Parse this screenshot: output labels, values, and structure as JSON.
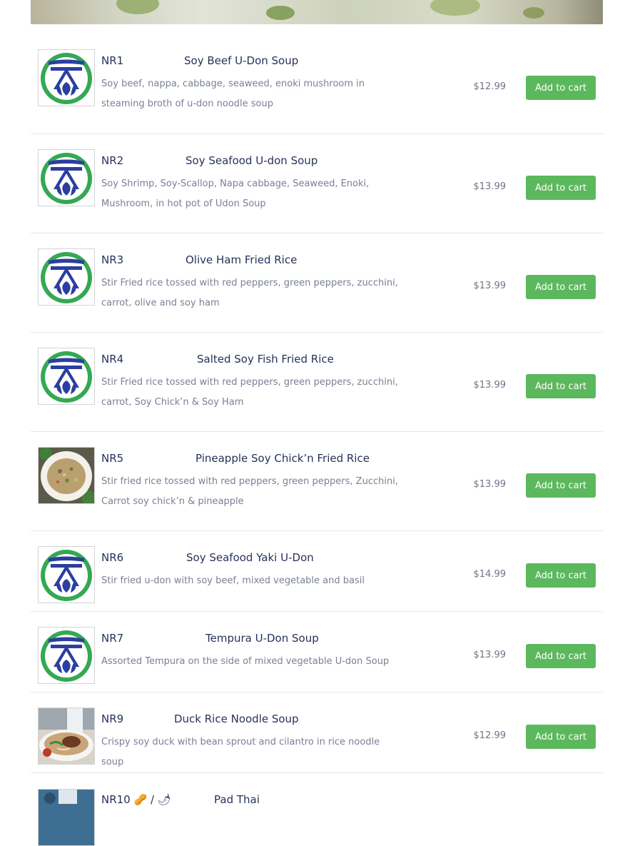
{
  "colors": {
    "accent": "#5cb85c",
    "title": "#27325a",
    "description": "#7a8095",
    "divider": "#e6e6e6"
  },
  "menu": {
    "items": [
      {
        "code": "NR1",
        "title": "Soy Beef U-Don Soup",
        "description": "Soy beef, nappa, cabbage, seaweed, enoki mushroom in steaming broth of u-don noodle soup",
        "price": "$12.99",
        "button": "Add to cart",
        "image": "logo-icon"
      },
      {
        "code": "NR2",
        "title": "Soy Seafood U-don Soup",
        "description": "Soy Shrimp, Soy-Scallop, Napa cabbage, Seaweed, Enoki, Mushroom, in hot pot of Udon Soup",
        "price": "$13.99",
        "button": "Add to cart",
        "image": "logo-icon"
      },
      {
        "code": "NR3",
        "title": "Olive Ham Fried Rice",
        "description": "Stir Fried rice tossed with red peppers, green peppers, zucchini, carrot, olive and soy ham",
        "price": "$13.99",
        "button": "Add to cart",
        "image": "logo-icon"
      },
      {
        "code": "NR4",
        "title": "Salted Soy Fish Fried Rice",
        "description": "Stir Fried rice tossed with red peppers, green peppers, zucchini, carrot, Soy Chick’n & Soy Ham",
        "price": "$13.99",
        "button": "Add to cart",
        "image": "logo-icon"
      },
      {
        "code": "NR5",
        "title": "Pineapple Soy Chick’n Fried Rice",
        "description": "Stir fried rice tossed with red peppers, green peppers, Zucchini, Carrot  soy chick’n & pineapple",
        "price": "$13.99",
        "button": "Add to cart",
        "image": "fried-rice-photo"
      },
      {
        "code": "NR6",
        "title": "Soy Seafood Yaki U-Don",
        "description": "Stir fried u-don with soy beef, mixed vegetable and basil",
        "price": "$14.99",
        "button": "Add to cart",
        "image": "logo-icon"
      },
      {
        "code": "NR7",
        "title": "Tempura U-Don Soup",
        "description": "Assorted Tempura on the side of mixed vegetable U-don Soup",
        "price": "$13.99",
        "button": "Add to cart",
        "image": "logo-icon"
      },
      {
        "code": "NR9",
        "title": "Duck Rice Noodle Soup",
        "description": "Crispy soy duck with bean sprout and cilantro in rice noodle soup",
        "price": "$12.99",
        "button": "Add to cart",
        "image": "noodle-soup-photo"
      },
      {
        "code": "NR10 🥜 / 🌶",
        "title": "Pad Thai",
        "description": "",
        "price": "",
        "button": "",
        "image": "pad-thai-photo"
      }
    ]
  }
}
